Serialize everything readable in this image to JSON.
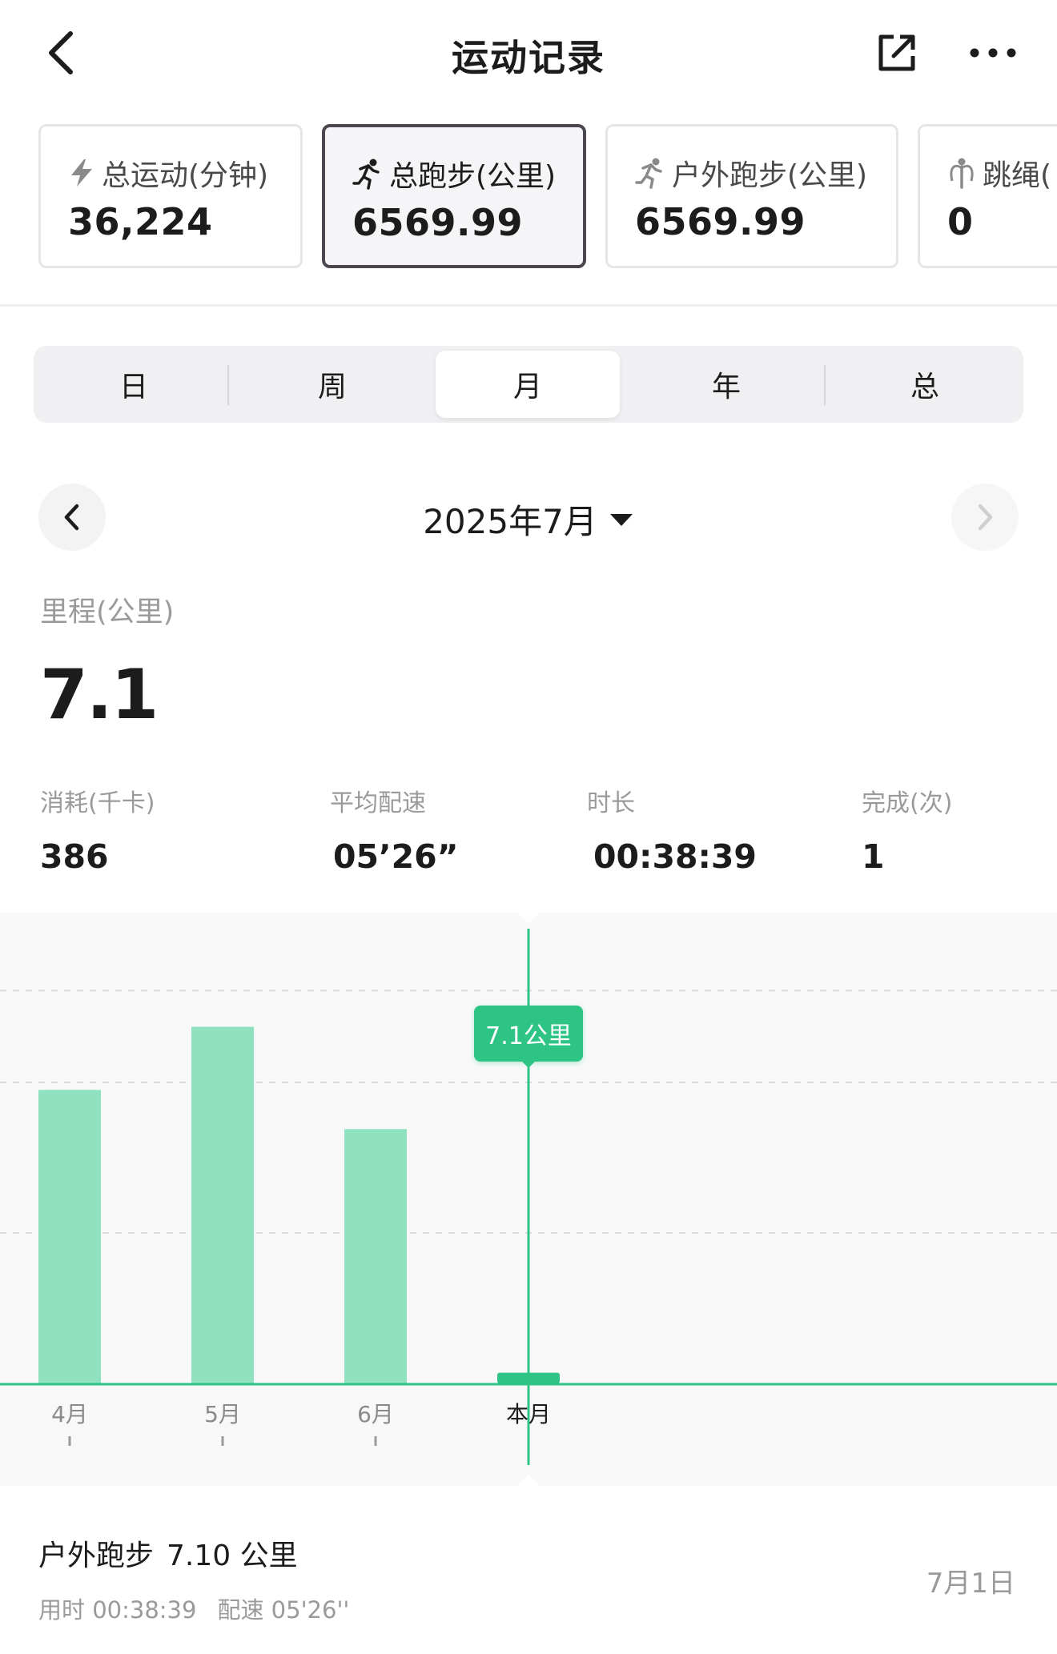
{
  "header": {
    "title": "运动记录"
  },
  "cards": [
    {
      "icon": "lightning-icon",
      "label": "总运动(分钟)",
      "value": "36,224"
    },
    {
      "icon": "runner-icon",
      "label": "总跑步(公里)",
      "value": "6569.99",
      "active": true
    },
    {
      "icon": "outdoor-runner-icon",
      "label": "户外跑步(公里)",
      "value": "6569.99"
    },
    {
      "icon": "jump-rope-icon",
      "label": "跳绳(",
      "value": "0"
    }
  ],
  "periods": [
    "日",
    "周",
    "月",
    "年",
    "总"
  ],
  "period_selected": "月",
  "date": {
    "label": "2025年7月"
  },
  "distance": {
    "label": "里程(公里)",
    "value": "7.1"
  },
  "metrics": [
    {
      "label": "消耗(千卡)",
      "value": "386"
    },
    {
      "label": "平均配速",
      "value": "05’26”"
    },
    {
      "label": "时长",
      "value": "00:38:39"
    },
    {
      "label": "完成(次)",
      "value": "1"
    }
  ],
  "chart_data": {
    "type": "bar",
    "categories": [
      "4月",
      "5月",
      "6月",
      "本月"
    ],
    "values": [
      195,
      237,
      169,
      7.1
    ],
    "selected": "本月",
    "tooltip": "7.1公里",
    "ylim": [
      0,
      300
    ],
    "grid": true
  },
  "record": {
    "type": "户外跑步",
    "distance": "7.10 公里",
    "duration": "用时 00:38:39",
    "pace": "配速 05'26''",
    "date": "7月1日"
  },
  "colors": {
    "accent": "#2ec485",
    "bar": "#8fe1c0",
    "active_border": "#4b4650"
  }
}
